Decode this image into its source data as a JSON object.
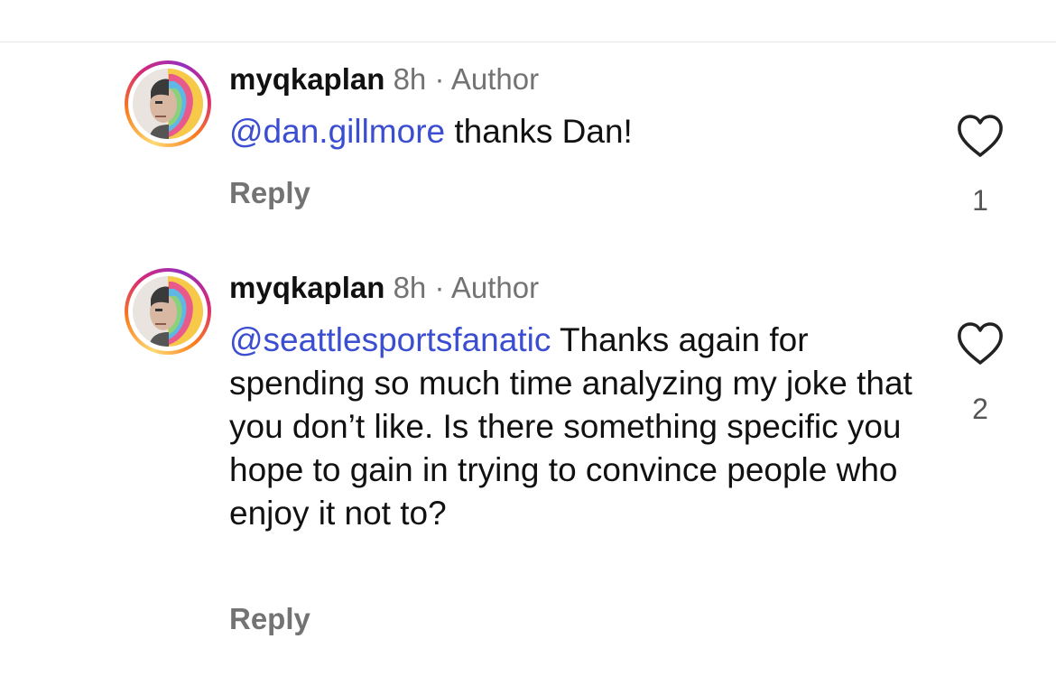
{
  "comments": [
    {
      "username": "myqkaplan",
      "time": "8h",
      "separator": "·",
      "role": "Author",
      "mention": "@dan.gillmore",
      "text": " thanks Dan!",
      "reply_label": "Reply",
      "like_count": "1"
    },
    {
      "username": "myqkaplan",
      "time": "8h",
      "separator": "·",
      "role": "Author",
      "mention": "@seattlesportsfanatic",
      "text": " Thanks again for spending so much time analyzing my joke that you don’t like. Is there something specific you hope to gain in trying to convince people who enjoy it not to?",
      "reply_label": "Reply",
      "like_count": "2"
    }
  ],
  "icons": {
    "like": "heart-outline-icon",
    "avatar": "avatar-image"
  },
  "colors": {
    "mention": "#3b4dd0",
    "meta": "#737373",
    "text": "#111111"
  }
}
